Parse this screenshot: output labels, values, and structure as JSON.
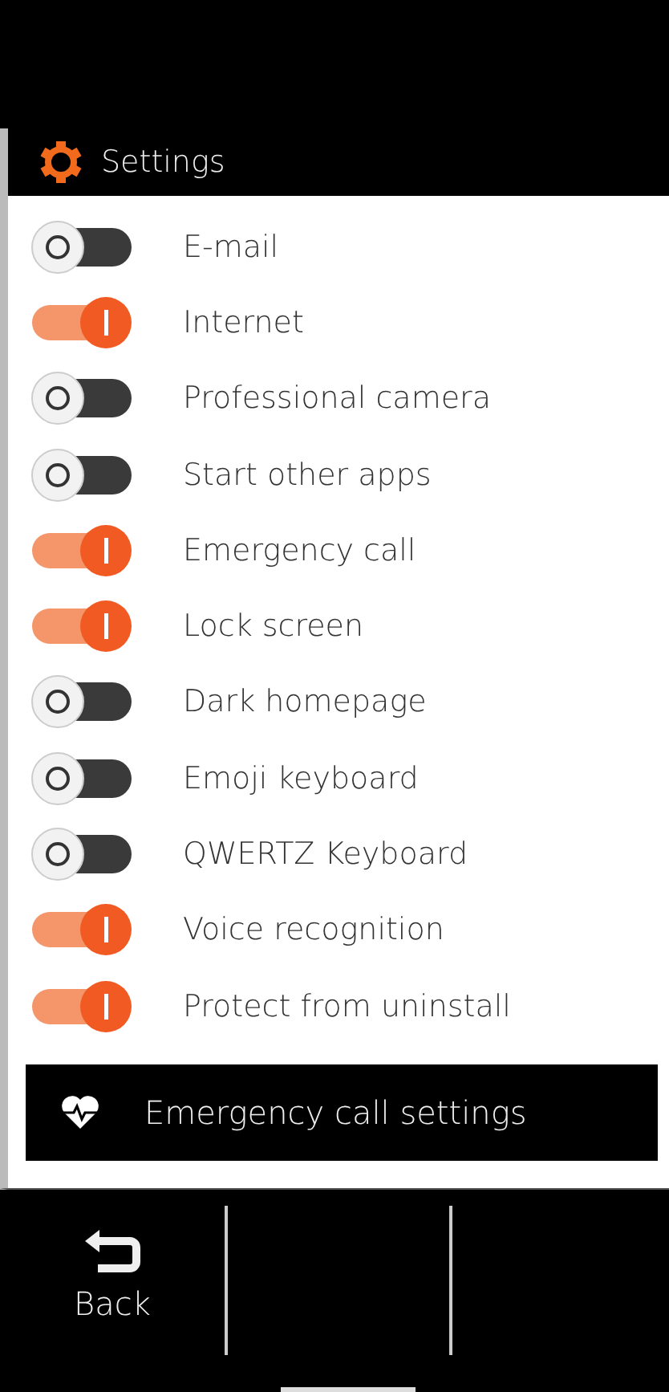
{
  "header": {
    "title": "Settings"
  },
  "settings": [
    {
      "label": "E-mail",
      "on": false
    },
    {
      "label": "Internet",
      "on": true
    },
    {
      "label": "Professional camera",
      "on": false
    },
    {
      "label": "Start other apps",
      "on": false
    },
    {
      "label": "Emergency call",
      "on": true
    },
    {
      "label": "Lock screen",
      "on": true
    },
    {
      "label": "Dark homepage",
      "on": false
    },
    {
      "label": "Emoji keyboard",
      "on": false
    },
    {
      "label": "QWERTZ Keyboard",
      "on": false
    },
    {
      "label": "Voice recognition",
      "on": true
    },
    {
      "label": "Protect from uninstall",
      "on": true
    }
  ],
  "action_button": {
    "label": "Emergency call settings"
  },
  "nav_bar": {
    "back_label": "Back"
  }
}
